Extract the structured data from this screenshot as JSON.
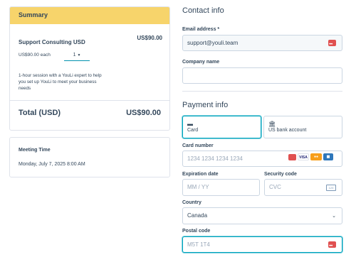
{
  "summary": {
    "header": "Summary",
    "item_name": "Support Consulting USD",
    "item_price": "US$90.00",
    "unit_price": "US$90.00 each",
    "quantity": "1",
    "description": "1-hour session with a YouLi expert to help you set up YouLi to meet your business needs",
    "total_label": "Total (USD)",
    "total_value": "US$90.00"
  },
  "meeting": {
    "title": "Meeting Time",
    "date": "Monday, July 7, 2025 8:00 AM"
  },
  "contact": {
    "title": "Contact info",
    "email_label": "Email address *",
    "email_value": "support@youli.team",
    "company_label": "Company name",
    "company_value": ""
  },
  "payment": {
    "title": "Payment info",
    "tabs": [
      {
        "label": "Card",
        "icon": "credit-card-icon"
      },
      {
        "label": "US bank account",
        "icon": "bank-icon"
      }
    ],
    "card_number_label": "Card number",
    "card_number_placeholder": "1234 1234 1234 1234",
    "brands": [
      "VISA",
      "mastercard",
      "amex"
    ],
    "expiration_label": "Expiration date",
    "expiration_placeholder": "MM / YY",
    "security_label": "Security code",
    "security_placeholder": "CVC",
    "country_label": "Country",
    "country_value": "Canada",
    "postal_label": "Postal code",
    "postal_placeholder": "M5T 1T4"
  },
  "colors": {
    "summary_header_bg": "#f7d46b",
    "focus_border": "#00a4bd",
    "text": "#33475b"
  }
}
